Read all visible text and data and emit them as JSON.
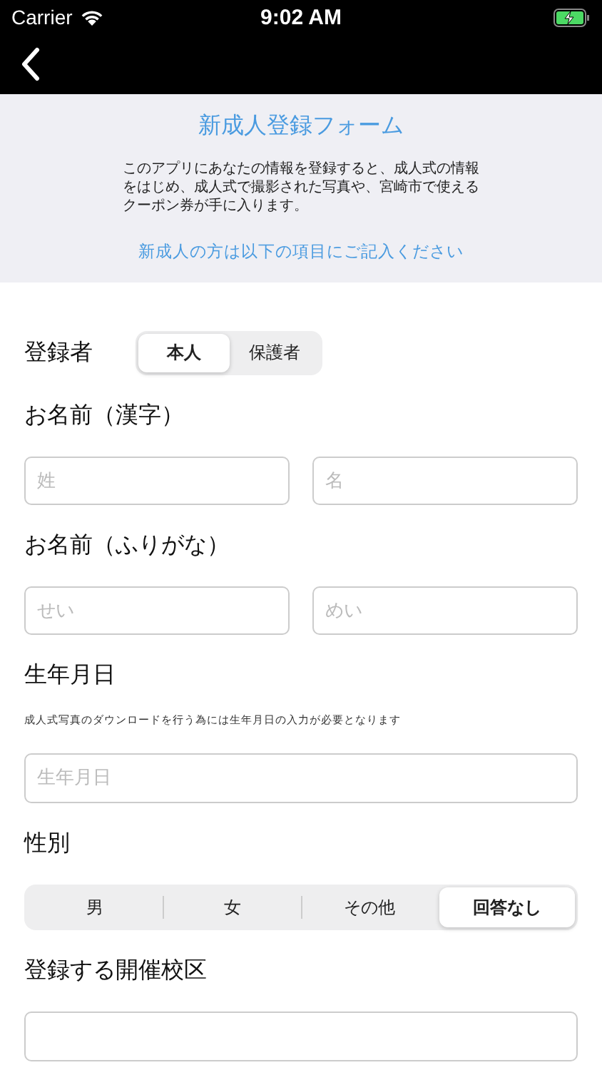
{
  "status_bar": {
    "carrier": "Carrier",
    "time": "9:02 AM",
    "charging": true
  },
  "header": {
    "title": "新成人登録フォーム",
    "description": "このアプリにあなたの情報を登録すると、成人式の情報をはじめ、成人式で撮影された写真や、宮崎市で使えるクーポン券が手に入ります。",
    "instruction": "新成人の方は以下の項目にご記入ください"
  },
  "sections": [
    {
      "kind": "inline_segmented",
      "label": "登録者",
      "options": [
        {
          "label": "本人",
          "selected": true
        },
        {
          "label": "保護者",
          "selected": false
        }
      ]
    },
    {
      "kind": "pair",
      "label": "お名前（漢字）",
      "fields": [
        {
          "placeholder": "姓"
        },
        {
          "placeholder": "名"
        }
      ]
    },
    {
      "kind": "pair",
      "label": "お名前（ふりがな）",
      "fields": [
        {
          "placeholder": "せい"
        },
        {
          "placeholder": "めい"
        }
      ]
    },
    {
      "kind": "single",
      "label": "生年月日",
      "note": "成人式写真のダウンロードを行う為には生年月日の入力が必要となります",
      "fields": [
        {
          "placeholder": "生年月日"
        }
      ]
    },
    {
      "kind": "segmented",
      "label": "性別",
      "options": [
        {
          "label": "男",
          "selected": false
        },
        {
          "label": "女",
          "selected": false
        },
        {
          "label": "その他",
          "selected": false
        },
        {
          "label": "回答なし",
          "selected": true
        }
      ]
    },
    {
      "kind": "blank_field",
      "label": "登録する開催校区"
    }
  ]
}
